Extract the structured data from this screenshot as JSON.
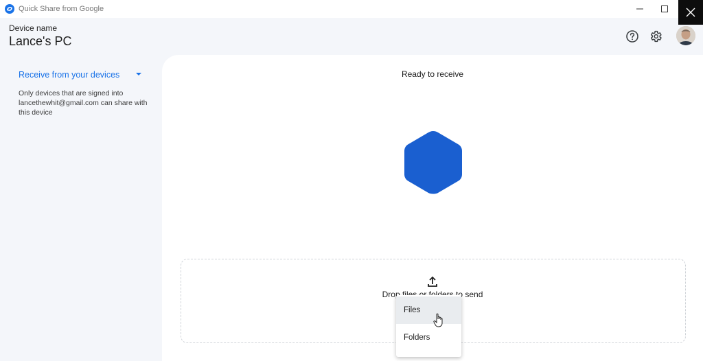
{
  "window": {
    "title": "Quick Share from Google"
  },
  "header": {
    "device_label": "Device name",
    "device_name": "Lance's PC",
    "icons": [
      "help-icon",
      "gear-icon",
      "avatar"
    ]
  },
  "sidebar": {
    "receive_mode": "Receive from your devices",
    "receive_description": "Only devices that are signed into lancethewhit@gmail.com can share with this device"
  },
  "main": {
    "status": "Ready to receive",
    "drop_text": "Drop files or folders to send",
    "hexagon_color": "#1a5fd0",
    "accent_color": "#1a73e8"
  },
  "menu": {
    "items": [
      {
        "label": "Files",
        "hovered": true
      },
      {
        "label": "Folders",
        "hovered": false
      }
    ]
  }
}
